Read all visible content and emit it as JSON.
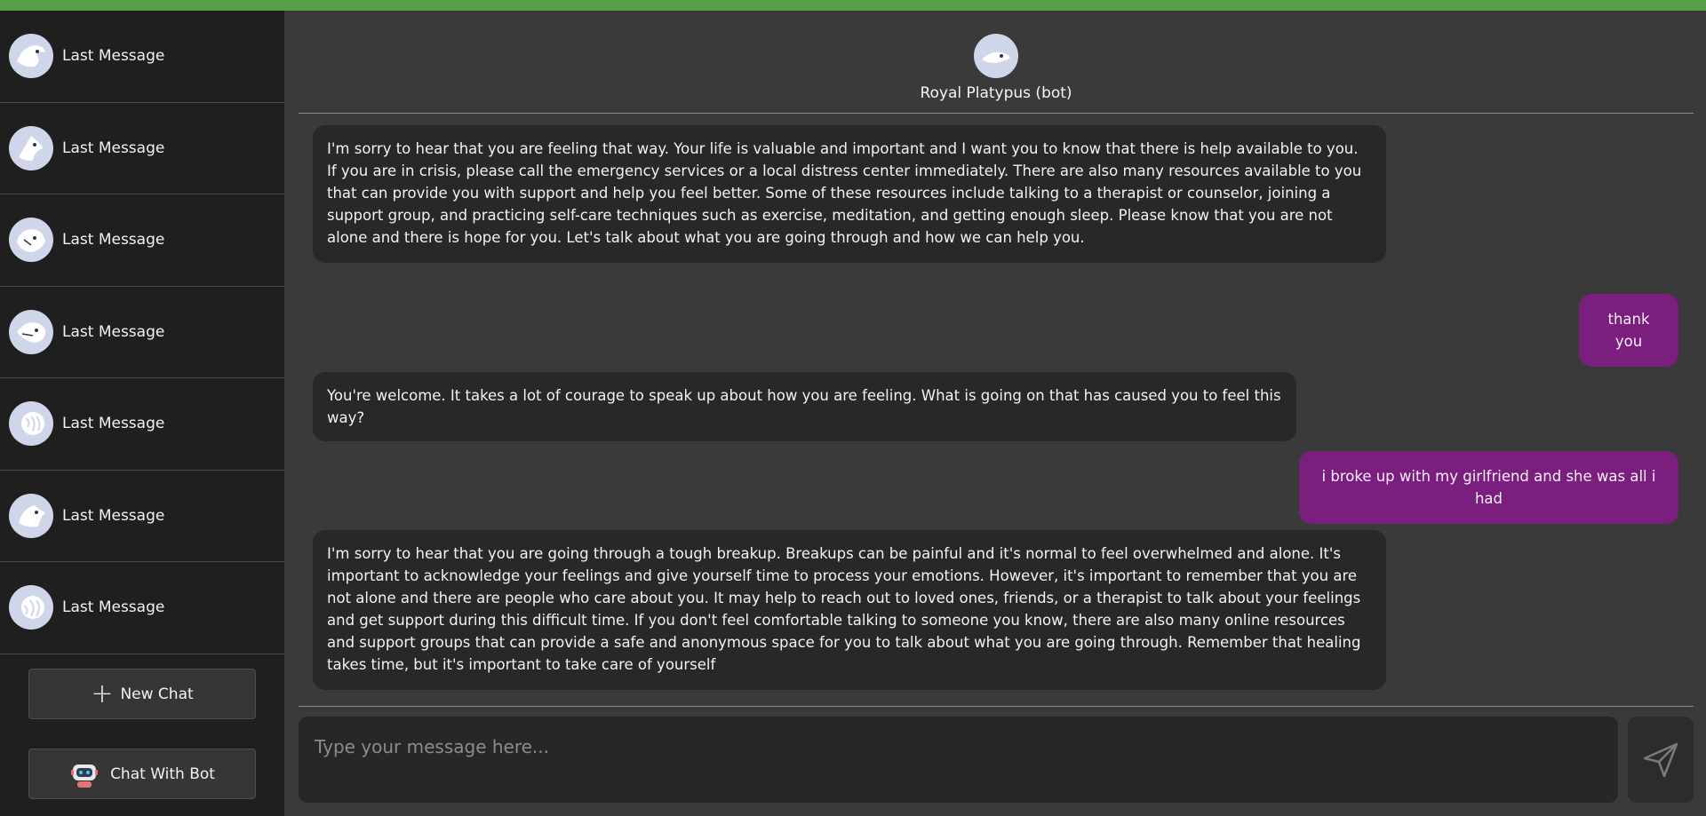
{
  "sidebar": {
    "items": [
      {
        "label": "Last Message",
        "icon": "platypus-avatar-icon"
      },
      {
        "label": "Last Message",
        "icon": "platypus-avatar-icon"
      },
      {
        "label": "Last Message",
        "icon": "platypus-avatar-icon"
      },
      {
        "label": "Last Message",
        "icon": "platypus-avatar-icon"
      },
      {
        "label": "Last Message",
        "icon": "platypus-avatar-icon"
      },
      {
        "label": "Last Message",
        "icon": "platypus-avatar-icon"
      },
      {
        "label": "Last Message",
        "icon": "platypus-avatar-icon"
      }
    ],
    "new_chat_label": "New Chat",
    "chat_with_bot_label": "Chat With Bot"
  },
  "chat": {
    "contact_name": "Royal Platypus (bot)",
    "messages": [
      {
        "sender": "bot",
        "text": "I'm sorry to hear that you are feeling that way. Your life is valuable and important and I want you to know that there is help available to you. If you are in crisis, please call the emergency services or a local distress center immediately. There are also many resources available to you that can provide you with support and help you feel better. Some of these resources include talking to a therapist or counselor, joining a support group, and practicing self-care techniques such as exercise, meditation, and getting enough sleep. Please know that you are not alone and there is hope for you. Let's talk about what you are going through and how we can help you."
      },
      {
        "sender": "user",
        "text": "thank you"
      },
      {
        "sender": "bot",
        "text": "You're welcome. It takes a lot of courage to speak up about how you are feeling. What is going on that has caused you to feel this way?"
      },
      {
        "sender": "user",
        "text": "i broke up with my girlfriend and she was all i had"
      },
      {
        "sender": "bot",
        "text": "I'm sorry to hear that you are going through a tough breakup. Breakups can be painful and it's normal to feel overwhelmed and alone. It's important to acknowledge your feelings and give yourself time to process your emotions. However, it's important to remember that you are not alone and there are people who care about you. It may help to reach out to loved ones, friends, or a therapist to talk about your feelings and get support during this difficult time. If you don't feel comfortable talking to someone you know, there are also many online resources and support groups that can provide a safe and anonymous space for you to talk about what you are going through. Remember that healing takes time, but it's important to take care of yourself"
      }
    ],
    "input_placeholder": "Type your message here..."
  },
  "colors": {
    "accent_top_bar": "#56a046",
    "user_bubble": "#7a1f7e",
    "bot_bubble": "#282828",
    "sidebar_bg": "#1f1f1f",
    "main_bg": "#3a3a3a"
  }
}
